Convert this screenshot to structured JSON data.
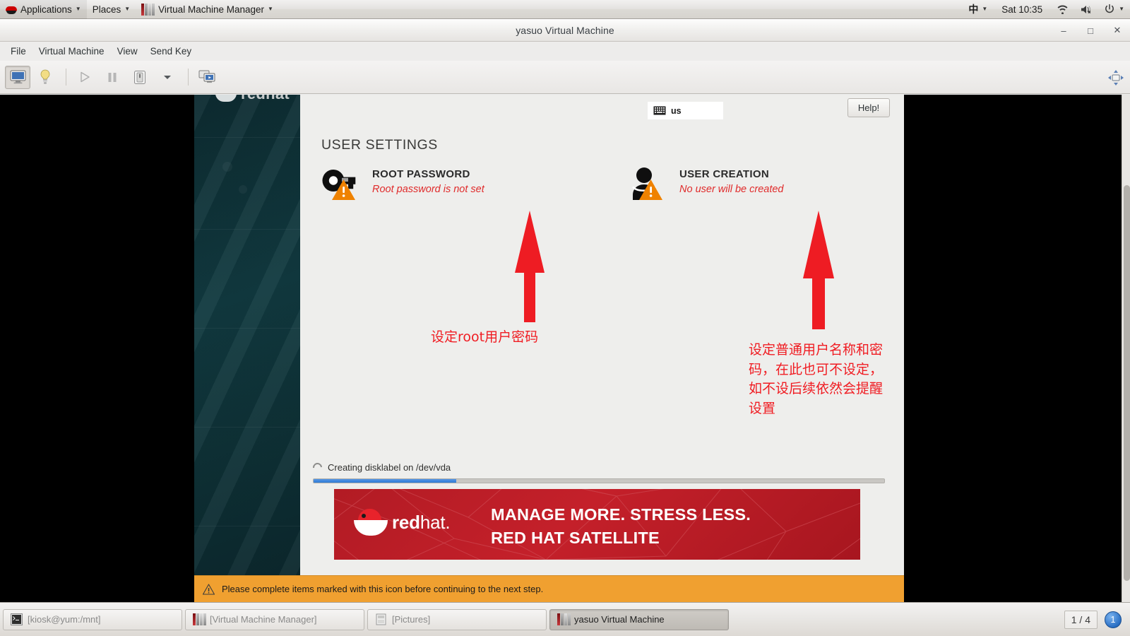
{
  "gnome_panel": {
    "applications_label": "Applications",
    "places_label": "Places",
    "window_menu_label": "Virtual Machine Manager",
    "ime_label": "中",
    "clock": "Sat 10:35",
    "icons": [
      "wifi-icon",
      "volume-muted-icon",
      "power-icon"
    ]
  },
  "vm_window": {
    "title": "yasuo Virtual Machine",
    "window_buttons": {
      "minimize": "–",
      "maximize": "□",
      "close": "✕"
    },
    "menu": [
      "File",
      "Virtual Machine",
      "View",
      "Send Key"
    ],
    "toolbar": {
      "console_label": "Show the graphical console",
      "details_label": "Show virtual hardware details",
      "run_label": "Run",
      "pause_label": "Pause",
      "shutdown_label": "Shut Down",
      "shutdown_menu_label": "Shut down options",
      "fullscreen_label": "Toggle fullscreen view"
    }
  },
  "installer": {
    "keyboard_layout": "us",
    "help_button": "Help!",
    "section_title": "USER SETTINGS",
    "spokes": [
      {
        "id": "root-password",
        "icon": "key-icon",
        "name": "ROOT PASSWORD",
        "status": "Root password is not set",
        "status_color": "#e02b2b"
      },
      {
        "id": "user-creation",
        "icon": "user-icon",
        "name": "USER CREATION",
        "status": "No user will be created",
        "status_color": "#e02b2b"
      }
    ],
    "annotations": [
      {
        "id": "root-password-note",
        "text": "设定root用户密码",
        "color": "#f01c22"
      },
      {
        "id": "user-creation-note",
        "text": "设定普通用户名称和密\n码，在此也可不设定，\n如不设后续依然会提醒\n设置",
        "color": "#f01c22"
      }
    ],
    "progress": {
      "status_text": "Creating disklabel on /dev/vda",
      "percent": 25
    },
    "banner": {
      "brand_bold": "red",
      "brand_light": "hat",
      "brand_dot": ".",
      "tagline_line1": "MANAGE MORE. STRESS LESS.",
      "tagline_line2": "RED HAT SATELLITE",
      "bg_color": "#c4202a"
    },
    "warning": {
      "icon": "warning-triangle-icon",
      "text": "Please complete items marked with this icon before continuing to the next step."
    },
    "sidebar_logo": "redhat"
  },
  "taskbar": {
    "tasks": [
      {
        "id": "terminal",
        "icon": "terminal-icon",
        "label": "[kiosk@yum:/mnt]",
        "state": "inactive"
      },
      {
        "id": "vmm",
        "icon": "vmm-icon",
        "label": "[Virtual Machine Manager]",
        "state": "inactive"
      },
      {
        "id": "pictures",
        "icon": "folder-icon",
        "label": "[Pictures]",
        "state": "inactive"
      },
      {
        "id": "yasuo-vm",
        "icon": "vmm-icon",
        "label": "yasuo Virtual Machine",
        "state": "current"
      }
    ],
    "workspace_indicator": "1 / 4",
    "workspace_badge": "1"
  }
}
